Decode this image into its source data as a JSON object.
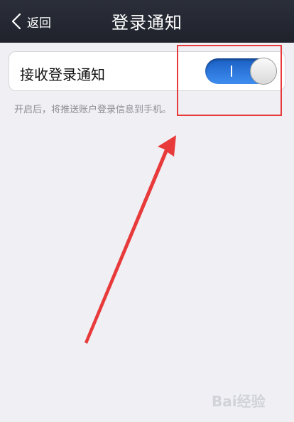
{
  "navbar": {
    "back_label": "返回",
    "title": "登录通知"
  },
  "setting": {
    "label": "接收登录通知",
    "toggle_state": "on"
  },
  "hint_text": "开启后，将推送账户登录信息到手机。",
  "annotation_color": "#e83a3a",
  "watermark_text": "Bai经验"
}
